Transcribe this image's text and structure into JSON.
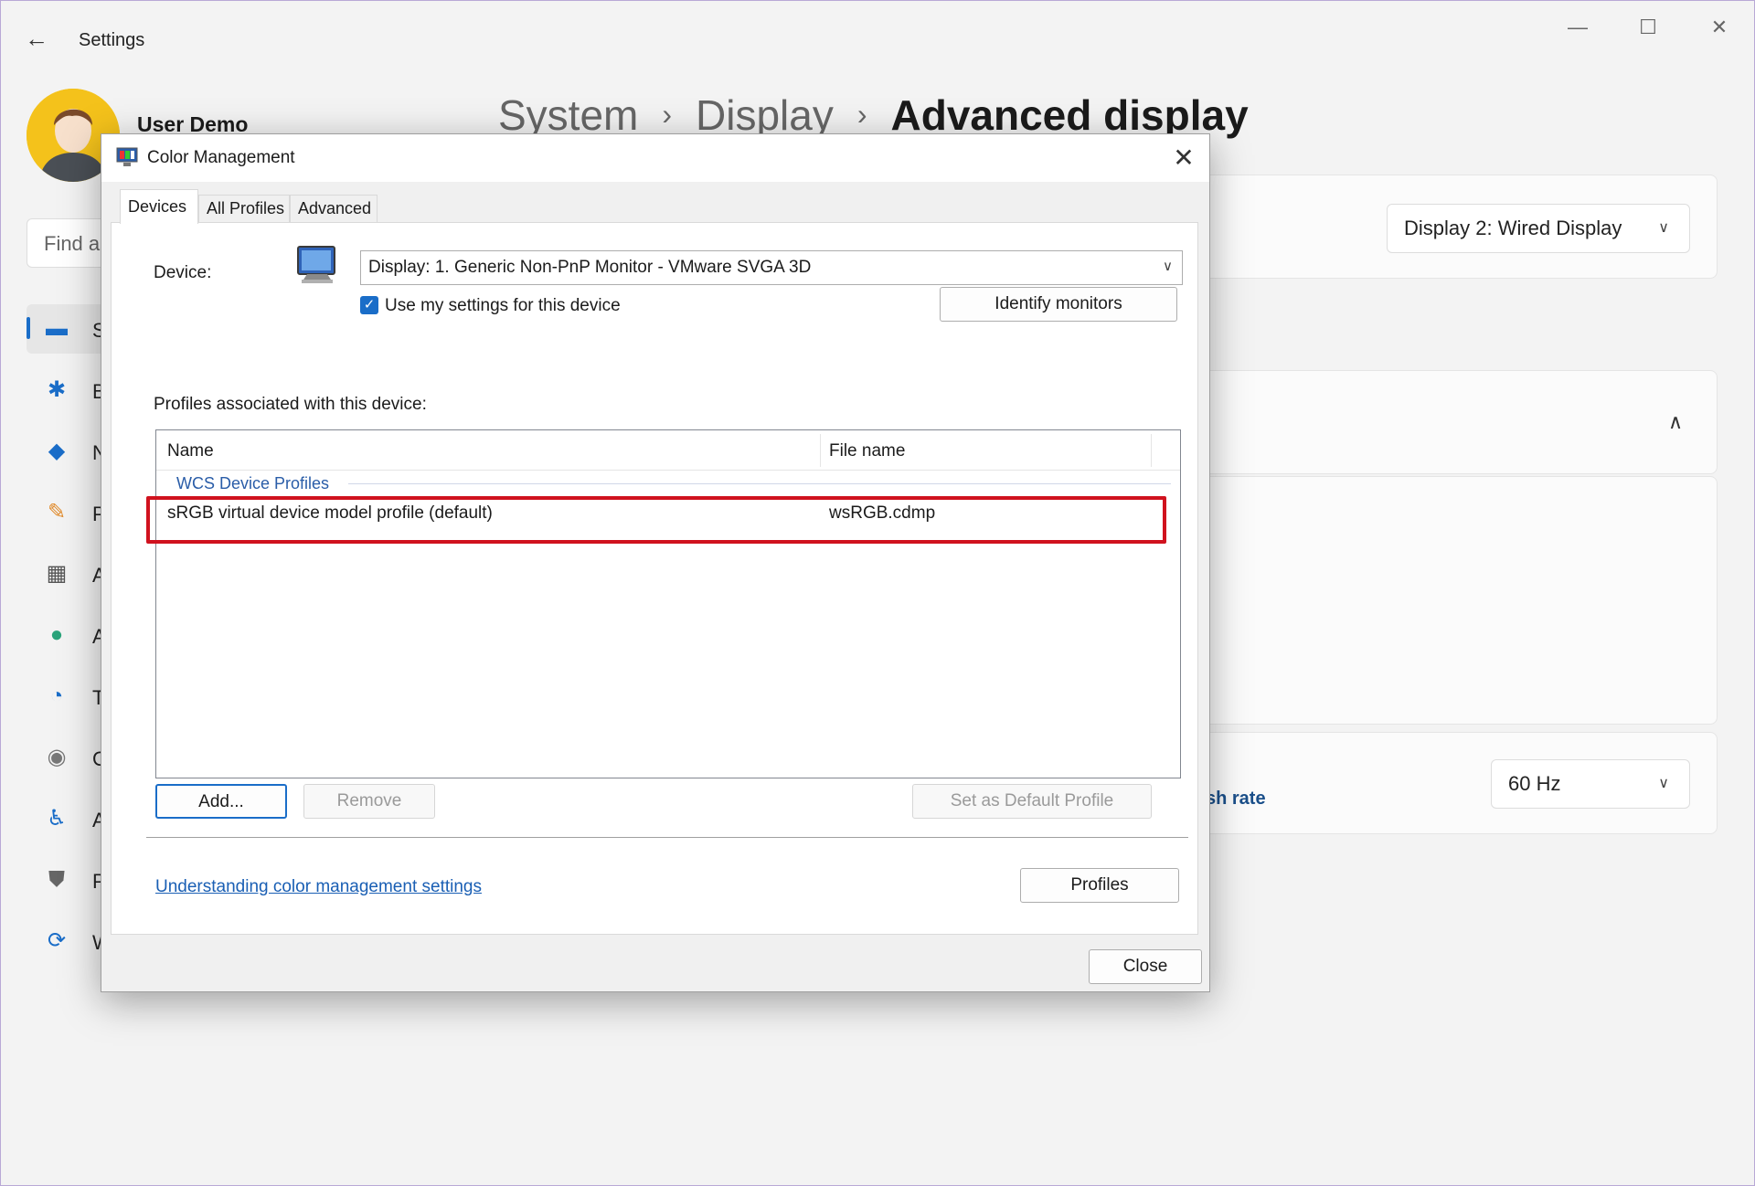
{
  "settings": {
    "title": "Settings",
    "user_name": "User Demo",
    "search_placeholder": "Find a",
    "breadcrumb": {
      "part1": "System",
      "part2": "Display",
      "current": "Advanced display"
    },
    "nav_letters": [
      "S",
      "B",
      "N",
      "P",
      "A",
      "A",
      "T",
      "G",
      "A",
      "P",
      "W"
    ],
    "display_select": "Display 2: Wired Display",
    "refresh_rate_label": "sh rate",
    "refresh_rate_value": "60 Hz",
    "accent_color": "#1a6dc8"
  },
  "dialog": {
    "title": "Color Management",
    "tabs": [
      "Devices",
      "All Profiles",
      "Advanced"
    ],
    "device_label": "Device:",
    "device_value": "Display: 1. Generic Non-PnP Monitor - VMware SVGA 3D",
    "use_settings_label": "Use my settings for this device",
    "identify_button": "Identify monitors",
    "profiles_assoc_label": "Profiles associated with this device:",
    "columns": [
      "Name",
      "File name"
    ],
    "group": "WCS Device Profiles",
    "rows": [
      {
        "name": "sRGB virtual device model profile (default)",
        "file": "wsRGB.cdmp"
      }
    ],
    "add_button": "Add...",
    "remove_button": "Remove",
    "set_default_button": "Set as Default Profile",
    "help_link": "Understanding color management settings",
    "profiles_button": "Profiles",
    "close_button": "Close",
    "highlight_color": "#d0121e"
  }
}
